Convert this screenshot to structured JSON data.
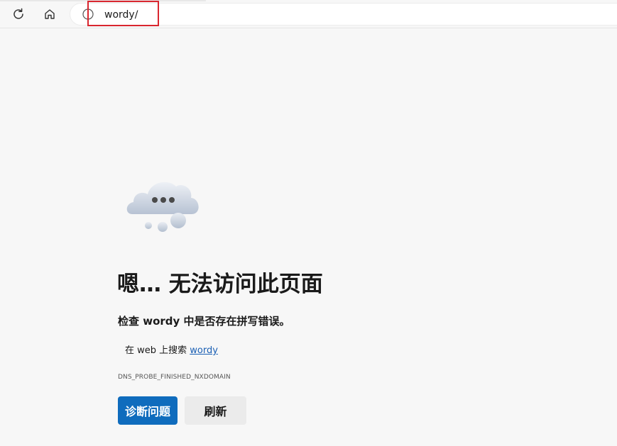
{
  "browser": {
    "address": "wordy/",
    "refresh_icon": "refresh-icon",
    "home_icon": "home-icon",
    "info_icon": "info-circle-icon",
    "highlight_color": "#d9262f"
  },
  "error_page": {
    "illustration_icon": "cloud-thinking-icon",
    "title": "嗯… 无法访问此页面",
    "suggestion": "检查 wordy 中是否存在拼写错误。",
    "search_prefix": "在 web 上搜索 ",
    "search_link": "wordy",
    "error_code": "DNS_PROBE_FINISHED_NXDOMAIN",
    "diagnose_button": "诊断问题",
    "reload_button": "刷新",
    "accent_color": "#0f6cbd"
  }
}
